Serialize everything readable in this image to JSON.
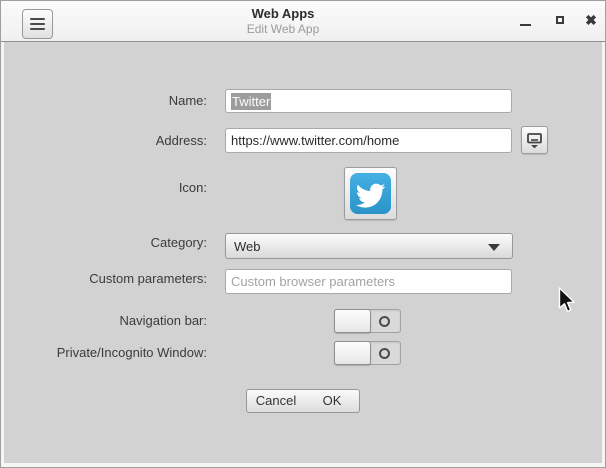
{
  "window": {
    "title": "Web Apps",
    "subtitle": "Edit Web App",
    "menu_button_icon": "hamburger-menu-icon",
    "controls": {
      "minimize_icon": "minimize-icon",
      "maximize_icon": "maximize-icon",
      "close_icon": "close-icon"
    }
  },
  "form": {
    "name": {
      "label": "Name:",
      "value": "Twitter",
      "text_selected": true
    },
    "address": {
      "label": "Address:",
      "value": "https://www.twitter.com/home",
      "favicon_button_icon": "download-favicon-icon"
    },
    "icon": {
      "label": "Icon:",
      "icon_name": "twitter-bird-icon"
    },
    "category": {
      "label": "Category:",
      "value": "Web",
      "arrow_icon": "dropdown-arrow-icon"
    },
    "custom_parameters": {
      "label": "Custom parameters:",
      "value": "",
      "placeholder": "Custom browser parameters"
    },
    "navigation_bar": {
      "label": "Navigation bar:",
      "state": "off"
    },
    "incognito": {
      "label": "Private/Incognito Window:",
      "state": "off"
    }
  },
  "actions": {
    "cancel_label": "Cancel",
    "ok_label": "OK"
  },
  "colors": {
    "twitter_blue_top": "#45b0e3",
    "twitter_blue_bottom": "#2a93c9",
    "content_bg": "#d2d2d2",
    "titlebar_bg": "#f5f5f5",
    "selection_bg": "#9d9d9d"
  }
}
